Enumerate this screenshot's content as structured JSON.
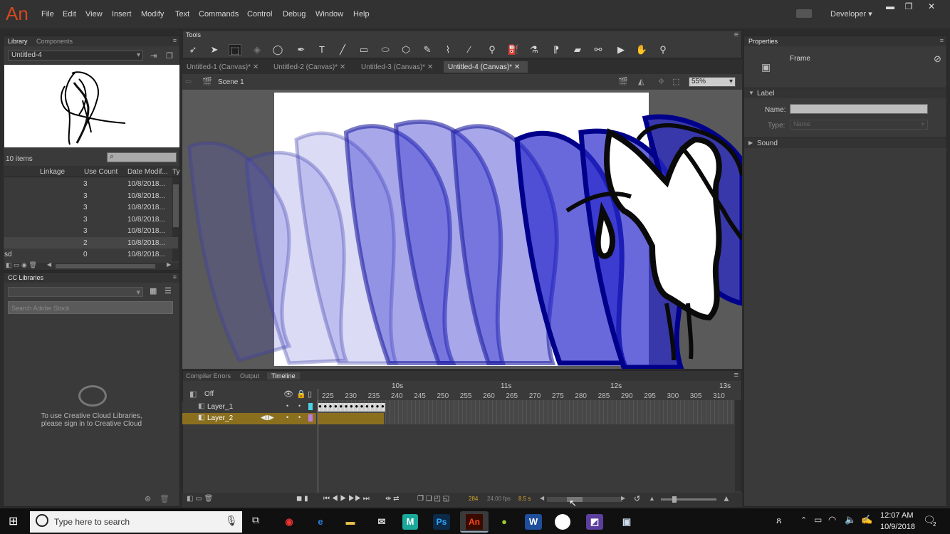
{
  "app": {
    "logo": "An",
    "workspace": "Developer",
    "win_min": "▬",
    "win_max": "❐",
    "win_close": "✕"
  },
  "menu": [
    "File",
    "Edit",
    "View",
    "Insert",
    "Modify",
    "Text",
    "Commands",
    "Control",
    "Debug",
    "Window",
    "Help"
  ],
  "library": {
    "tabs": [
      "Library",
      "Components"
    ],
    "doc_select": "Untitled-4",
    "item_count": "10 items",
    "columns": [
      "Linkage",
      "Use Count",
      "Date Modif...",
      "Ty"
    ],
    "rows": [
      {
        "name": "",
        "count": "3",
        "date": "10/8/2018..."
      },
      {
        "name": "",
        "count": "3",
        "date": "10/8/2018..."
      },
      {
        "name": "",
        "count": "3",
        "date": "10/8/2018..."
      },
      {
        "name": "",
        "count": "3",
        "date": "10/8/2018..."
      },
      {
        "name": "",
        "count": "3",
        "date": "10/8/2018..."
      },
      {
        "name": "",
        "count": "2",
        "date": "10/8/2018..."
      },
      {
        "name": "sd",
        "count": "0",
        "date": "10/8/2018..."
      }
    ]
  },
  "cclib": {
    "title": "CC Libraries",
    "search_placeholder": "Search Adobe Stock",
    "message_line1": "To use Creative Cloud Libraries,",
    "message_line2": "please sign in to Creative Cloud"
  },
  "tools": {
    "title": "Tools"
  },
  "doc_tabs": [
    "Untitled-1 (Canvas)*",
    "Untitled-2 (Canvas)*",
    "Untitled-3 (Canvas)*",
    "Untitled-4 (Canvas)*"
  ],
  "stage": {
    "scene": "Scene 1",
    "zoom": "55%"
  },
  "timeline": {
    "tabs": [
      "Compiler Errors",
      "Output",
      "Timeline"
    ],
    "onion": "Off",
    "seconds": [
      "10s",
      "11s",
      "12s",
      "13s"
    ],
    "frames": [
      "225",
      "230",
      "235",
      "240",
      "245",
      "250",
      "255",
      "260",
      "265",
      "270",
      "275",
      "280",
      "285",
      "290",
      "295",
      "300",
      "305",
      "310"
    ],
    "layers": [
      "Layer_1",
      "Layer_2"
    ],
    "status_frame": "284",
    "status_fps": "24.00 fps",
    "status_time": "8.5 s"
  },
  "properties": {
    "tab": "Properties",
    "type": "Frame",
    "label_section": "Label",
    "name_label": "Name:",
    "type_label": "Type:",
    "type_value": "Name",
    "sound_section": "Sound"
  },
  "taskbar": {
    "search_placeholder": "Type here to search",
    "time": "12:07 AM",
    "date": "10/9/2018",
    "notif_count": "2",
    "apps": [
      "Ps",
      "An",
      "W"
    ]
  },
  "colors": {
    "accent": "#d4491f",
    "layer_selected": "#8a6f1e",
    "stroke": "#00008b",
    "ink": "#0a0a0a"
  }
}
